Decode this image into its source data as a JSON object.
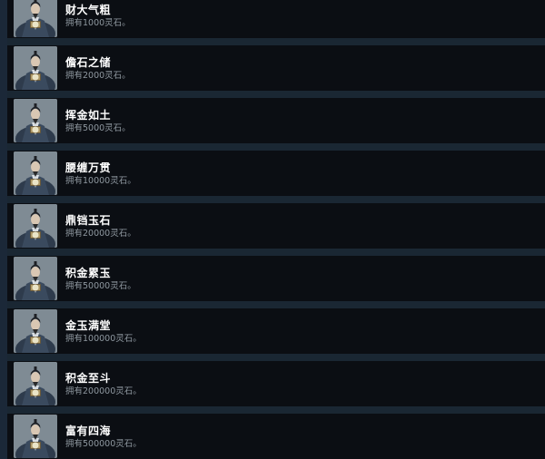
{
  "achievements": [
    {
      "title": "财大气粗",
      "description": "拥有1000灵石。",
      "icon": "cultivator-portrait-icon"
    },
    {
      "title": "儋石之储",
      "description": "拥有2000灵石。",
      "icon": "cultivator-portrait-icon"
    },
    {
      "title": "挥金如土",
      "description": "拥有5000灵石。",
      "icon": "cultivator-portrait-icon"
    },
    {
      "title": "腰缠万贯",
      "description": "拥有10000灵石。",
      "icon": "cultivator-portrait-icon"
    },
    {
      "title": "鼎铛玉石",
      "description": "拥有20000灵石。",
      "icon": "cultivator-portrait-icon"
    },
    {
      "title": "积金累玉",
      "description": "拥有50000灵石。",
      "icon": "cultivator-portrait-icon"
    },
    {
      "title": "金玉满堂",
      "description": "拥有100000灵石。",
      "icon": "cultivator-portrait-icon"
    },
    {
      "title": "积金至斗",
      "description": "拥有200000灵石。",
      "icon": "cultivator-portrait-icon"
    },
    {
      "title": "富有四海",
      "description": "拥有500000灵石。",
      "icon": "cultivator-portrait-icon"
    }
  ]
}
